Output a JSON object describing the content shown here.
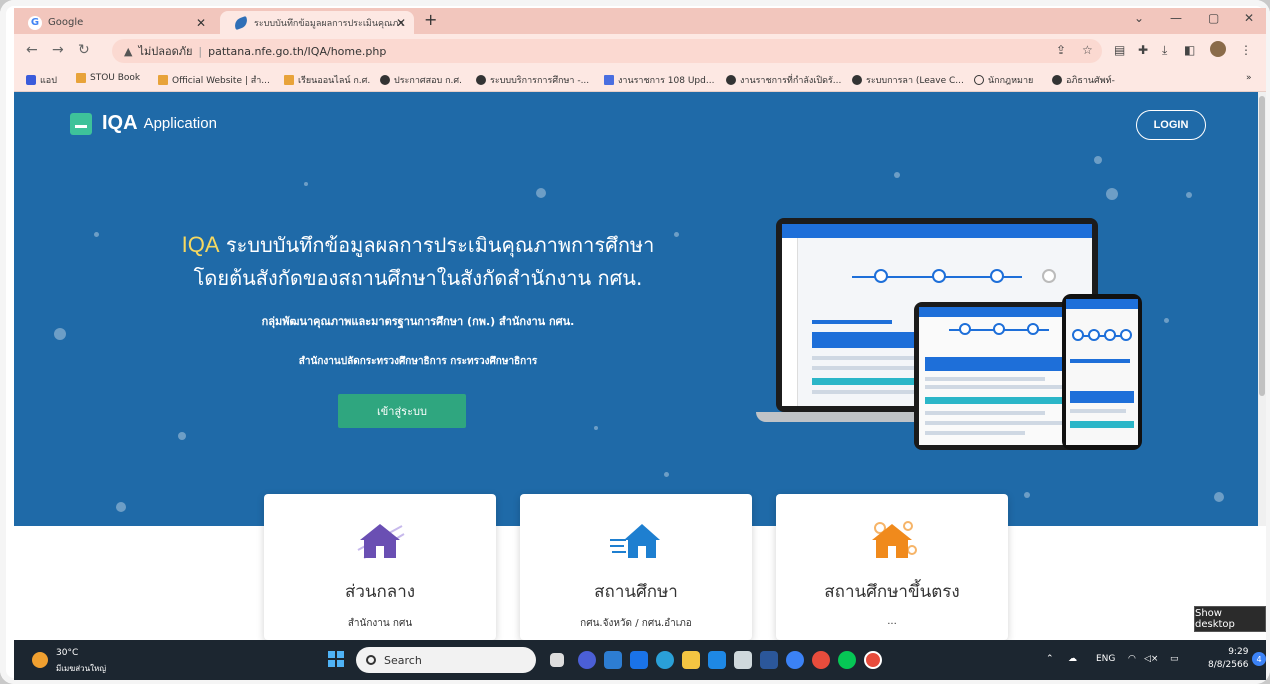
{
  "browser": {
    "tabs": [
      {
        "title": "Google"
      },
      {
        "title": "ระบบบันทึกข้อมูลผลการประเมินคุณภา"
      }
    ],
    "new_tab": "+",
    "address": {
      "security": "ไม่ปลอดภัย",
      "url": "pattana.nfe.go.th/IQA/home.php"
    },
    "bookmarks": [
      "แอป",
      "STOU Book",
      "Official Website | สำ...",
      "เรียนออนไลน์ ก.ศ.",
      "ประกาศสอบ ก.ศ.",
      "ระบบบริการการศึกษา -...",
      "งานราชการ 108 Upd...",
      "งานราชการที่กำลังเปิดรั...",
      "ระบบการลา (Leave C...",
      "นักกฎหมาย",
      "อภิธานศัพท์-"
    ]
  },
  "page": {
    "logo_name": "IQA",
    "logo_sub": "Application",
    "login": "LOGIN",
    "title_prefix": "IQA",
    "title_line1": "ระบบบันทึกข้อมูลผลการประเมินคุณภาพการศึกษา",
    "title_line2": "โดยต้นสังกัดของสถานศึกษาในสังกัดสำนักงาน กศน.",
    "subtitle1": "กลุ่มพัฒนาคุณภาพและมาตรฐานการศึกษา (กพ.) สำนักงาน กศน.",
    "subtitle2": "สำนักงานปลัดกระทรวงศึกษาธิการ กระทรวงศึกษาธิการ",
    "enter_button": "เข้าสู่ระบบ",
    "cards": [
      {
        "title": "ส่วนกลาง",
        "sub": "สำนักงาน กศน",
        "icon": "house-purple-icon",
        "color": "#6a4fb3"
      },
      {
        "title": "สถานศึกษา",
        "sub": "กศน.จังหวัด / กศน.อำเภอ",
        "icon": "house-blue-icon",
        "color": "#1e7fd0"
      },
      {
        "title": "สถานศึกษาขึ้นตรง",
        "sub": "...",
        "icon": "house-orange-icon",
        "color": "#f08a1c"
      }
    ]
  },
  "taskbar": {
    "weather_temp": "30°C",
    "weather_desc": "มีเมฆส่วนใหญ่",
    "search": "Search",
    "lang": "ENG",
    "time": "9:29",
    "date": "8/8/2566",
    "notif": "4",
    "show_desktop": "Show desktop"
  }
}
